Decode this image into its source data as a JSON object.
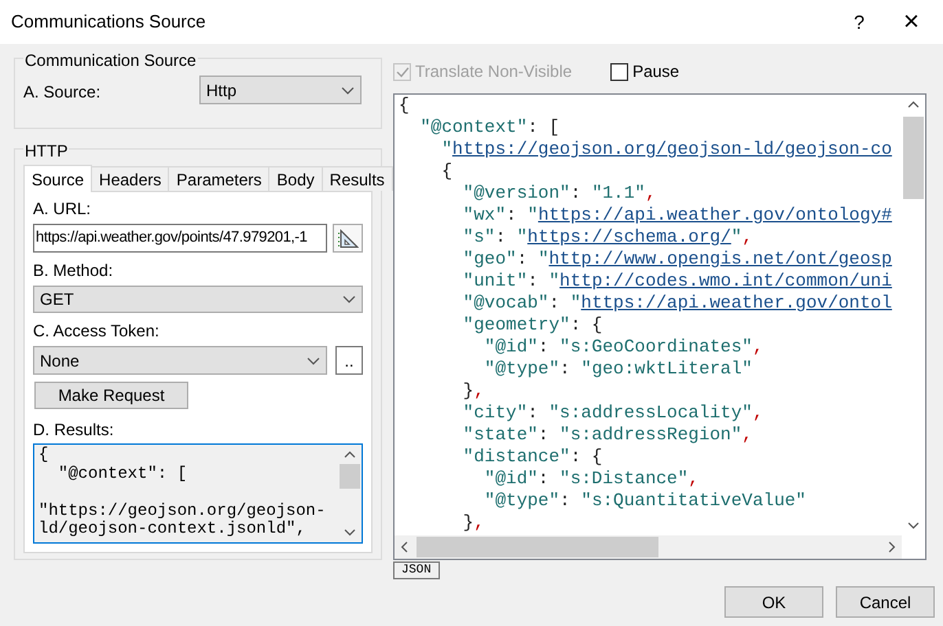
{
  "window": {
    "title": "Communications Source",
    "help": "?",
    "close": "×"
  },
  "communication_source": {
    "title": "Communication Source",
    "source_label": "A. Source:",
    "source_value": "Http"
  },
  "http": {
    "title": "HTTP",
    "tabs": [
      {
        "label": "Source",
        "selected": true
      },
      {
        "label": "Headers",
        "selected": false
      },
      {
        "label": "Parameters",
        "selected": false
      },
      {
        "label": "Body",
        "selected": false
      },
      {
        "label": "Results",
        "selected": false
      }
    ],
    "url_label": "A. URL:",
    "url_value": "https://api.weather.gov/points/47.979201,-1",
    "method_label": "B. Method:",
    "method_value": "GET",
    "token_label": "C. Access Token:",
    "token_value": "None",
    "token_button": "..",
    "make_request": "Make Request",
    "results_label": "D. Results:",
    "results_text": "{\n  \"@context\": [\n\n\"https://geojson.org/geojson-\nld/geojson-context.jsonld\","
  },
  "translate_non_visible": {
    "label": "Translate Non-Visible",
    "checked": true,
    "disabled": true
  },
  "pause": {
    "label": "Pause",
    "checked": false
  },
  "viewer_lines": [
    [
      {
        "kind": "punct",
        "text": "{"
      }
    ],
    [
      {
        "kind": "str",
        "text": "  \"@context\""
      },
      {
        "kind": "punct",
        "text": ": ["
      }
    ],
    [
      {
        "kind": "str",
        "text": "    \""
      },
      {
        "kind": "link",
        "text": "https://geojson.org/geojson-ld/geojson-co"
      }
    ],
    [
      {
        "kind": "punct",
        "text": "    {"
      }
    ],
    [
      {
        "kind": "str",
        "text": "      \"@version\""
      },
      {
        "kind": "punct",
        "text": ": "
      },
      {
        "kind": "str",
        "text": "\"1.1\""
      },
      {
        "kind": "comma",
        "text": ","
      }
    ],
    [
      {
        "kind": "str",
        "text": "      \"wx\""
      },
      {
        "kind": "punct",
        "text": ": "
      },
      {
        "kind": "str",
        "text": "\""
      },
      {
        "kind": "link",
        "text": "https://api.weather.gov/ontology#"
      }
    ],
    [
      {
        "kind": "str",
        "text": "      \"s\""
      },
      {
        "kind": "punct",
        "text": ": "
      },
      {
        "kind": "str",
        "text": "\""
      },
      {
        "kind": "link",
        "text": "https://schema.org/"
      },
      {
        "kind": "str",
        "text": "\""
      },
      {
        "kind": "comma",
        "text": ","
      }
    ],
    [
      {
        "kind": "str",
        "text": "      \"geo\""
      },
      {
        "kind": "punct",
        "text": ": "
      },
      {
        "kind": "str",
        "text": "\""
      },
      {
        "kind": "link",
        "text": "http://www.opengis.net/ont/geosp"
      }
    ],
    [
      {
        "kind": "str",
        "text": "      \"unit\""
      },
      {
        "kind": "punct",
        "text": ": "
      },
      {
        "kind": "str",
        "text": "\""
      },
      {
        "kind": "link",
        "text": "http://codes.wmo.int/common/uni"
      }
    ],
    [
      {
        "kind": "str",
        "text": "      \"@vocab\""
      },
      {
        "kind": "punct",
        "text": ": "
      },
      {
        "kind": "str",
        "text": "\""
      },
      {
        "kind": "link",
        "text": "https://api.weather.gov/ontol"
      }
    ],
    [
      {
        "kind": "str",
        "text": "      \"geometry\""
      },
      {
        "kind": "punct",
        "text": ": {"
      }
    ],
    [
      {
        "kind": "str",
        "text": "        \"@id\""
      },
      {
        "kind": "punct",
        "text": ": "
      },
      {
        "kind": "str",
        "text": "\"s:GeoCoordinates\""
      },
      {
        "kind": "comma",
        "text": ","
      }
    ],
    [
      {
        "kind": "str",
        "text": "        \"@type\""
      },
      {
        "kind": "punct",
        "text": ": "
      },
      {
        "kind": "str",
        "text": "\"geo:wktLiteral\""
      }
    ],
    [
      {
        "kind": "punct",
        "text": "      }"
      },
      {
        "kind": "comma",
        "text": ","
      }
    ],
    [
      {
        "kind": "str",
        "text": "      \"city\""
      },
      {
        "kind": "punct",
        "text": ": "
      },
      {
        "kind": "str",
        "text": "\"s:addressLocality\""
      },
      {
        "kind": "comma",
        "text": ","
      }
    ],
    [
      {
        "kind": "str",
        "text": "      \"state\""
      },
      {
        "kind": "punct",
        "text": ": "
      },
      {
        "kind": "str",
        "text": "\"s:addressRegion\""
      },
      {
        "kind": "comma",
        "text": ","
      }
    ],
    [
      {
        "kind": "str",
        "text": "      \"distance\""
      },
      {
        "kind": "punct",
        "text": ": {"
      }
    ],
    [
      {
        "kind": "str",
        "text": "        \"@id\""
      },
      {
        "kind": "punct",
        "text": ": "
      },
      {
        "kind": "str",
        "text": "\"s:Distance\""
      },
      {
        "kind": "comma",
        "text": ","
      }
    ],
    [
      {
        "kind": "str",
        "text": "        \"@type\""
      },
      {
        "kind": "punct",
        "text": ": "
      },
      {
        "kind": "str",
        "text": "\"s:QuantitativeValue\""
      }
    ],
    [
      {
        "kind": "punct",
        "text": "      }"
      },
      {
        "kind": "comma",
        "text": ","
      }
    ]
  ],
  "format_button": "JSON",
  "buttons": [
    "OK",
    "Cancel"
  ]
}
